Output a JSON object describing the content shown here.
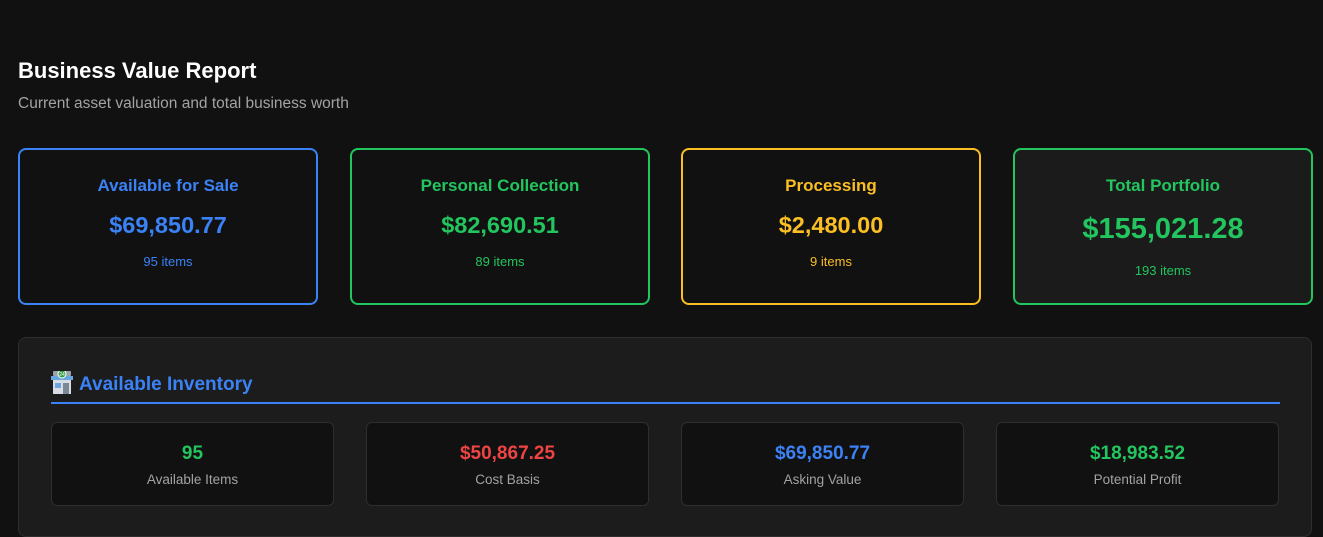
{
  "header": {
    "title": "Business Value Report",
    "subtitle": "Current asset valuation and total business worth"
  },
  "colors": {
    "blue": "#3b82f6",
    "green": "#22c55e",
    "amber": "#fbbf24",
    "red": "#ef4444"
  },
  "summary_cards": [
    {
      "title": "Available for Sale",
      "value": "$69,850.77",
      "count": "95 items",
      "color": "blue"
    },
    {
      "title": "Personal Collection",
      "value": "$82,690.51",
      "count": "89 items",
      "color": "green"
    },
    {
      "title": "Processing",
      "value": "$2,480.00",
      "count": "9 items",
      "color": "amber"
    },
    {
      "title": "Total Portfolio",
      "value": "$155,021.28",
      "count": "193 items",
      "color": "green"
    }
  ],
  "inventory": {
    "icon": "store-icon",
    "title": "Available Inventory",
    "stats": [
      {
        "value": "95",
        "label": "Available Items",
        "color": "green"
      },
      {
        "value": "$50,867.25",
        "label": "Cost Basis",
        "color": "red"
      },
      {
        "value": "$69,850.77",
        "label": "Asking Value",
        "color": "blue"
      },
      {
        "value": "$18,983.52",
        "label": "Potential Profit",
        "color": "green"
      }
    ]
  }
}
